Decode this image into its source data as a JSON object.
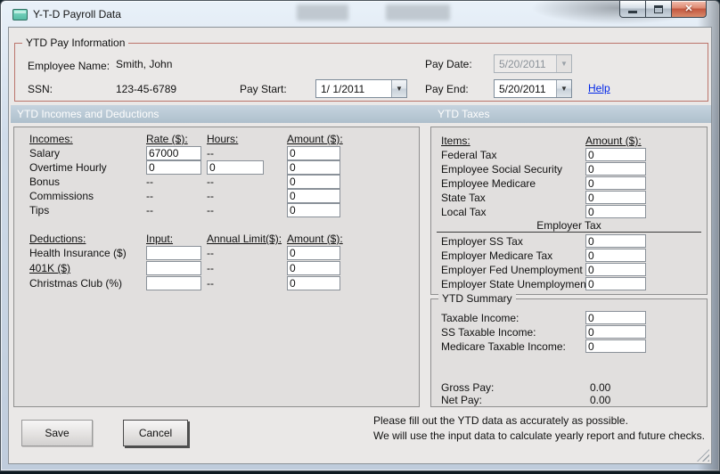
{
  "window": {
    "title": "Y-T-D Payroll Data"
  },
  "icons": {
    "dropdown_arrow": "▼",
    "close": "✕"
  },
  "pay_info": {
    "group_title": "YTD Pay Information",
    "employee_name_label": "Employee Name:",
    "employee_name_value": "Smith, John",
    "ssn_label": "SSN:",
    "ssn_value": "123-45-6789",
    "pay_start_label": "Pay Start:",
    "pay_start_value": "1/ 1/2011",
    "pay_date_label": "Pay Date:",
    "pay_date_value": "5/20/2011",
    "pay_end_label": "Pay End:",
    "pay_end_value": "5/20/2011",
    "help_label": "Help"
  },
  "section_headers": {
    "left": "YTD Incomes and Deductions",
    "right": "YTD Taxes"
  },
  "incomes": {
    "headers": {
      "col1": "Incomes:",
      "col2": "Rate ($):",
      "col3": "Hours:",
      "col4": "Amount ($):"
    },
    "rows": [
      {
        "label": "Salary",
        "rate": "67000",
        "hours": "--",
        "amount": "0"
      },
      {
        "label": "Overtime Hourly",
        "rate": "0",
        "hours": "0",
        "amount": "0"
      },
      {
        "label": "Bonus",
        "rate": "--",
        "hours": "--",
        "amount": "0"
      },
      {
        "label": "Commissions",
        "rate": "--",
        "hours": "--",
        "amount": "0"
      },
      {
        "label": "Tips",
        "rate": "--",
        "hours": "--",
        "amount": "0"
      }
    ]
  },
  "deductions": {
    "headers": {
      "col1": "Deductions:",
      "col2": "Input:",
      "col3": "Annual Limit($):",
      "col4": "Amount ($):"
    },
    "rows": [
      {
        "label": "Health Insurance ($)",
        "input": "",
        "limit": "--",
        "amount": "0"
      },
      {
        "label": "401K ($)",
        "input": "",
        "limit": "--",
        "amount": "0"
      },
      {
        "label": "Christmas Club (%)",
        "input": "",
        "limit": "--",
        "amount": "0"
      }
    ]
  },
  "taxes": {
    "headers": {
      "col1": "Items:",
      "col2": "Amount ($):"
    },
    "employee_rows": [
      {
        "label": "Federal Tax",
        "amount": "0"
      },
      {
        "label": "Employee Social Security",
        "amount": "0"
      },
      {
        "label": "Employee Medicare",
        "amount": "0"
      },
      {
        "label": "State Tax",
        "amount": "0"
      },
      {
        "label": "Local Tax",
        "amount": "0"
      }
    ],
    "employer_header": "Employer Tax",
    "employer_rows": [
      {
        "label": "Employer SS Tax",
        "amount": "0"
      },
      {
        "label": "Employer Medicare Tax",
        "amount": "0"
      },
      {
        "label": "Employer Fed Unemployment",
        "amount": "0"
      },
      {
        "label": "Employer State Unemployment",
        "amount": "0"
      }
    ]
  },
  "summary": {
    "group_title": "YTD Summary",
    "rows": [
      {
        "label": "Taxable Income:",
        "value": "0"
      },
      {
        "label": "SS Taxable Income:",
        "value": "0"
      },
      {
        "label": "Medicare Taxable Income:",
        "value": "0"
      }
    ],
    "gross_pay_label": "Gross Pay:",
    "gross_pay_value": "0.00",
    "net_pay_label": "Net Pay:",
    "net_pay_value": "0.00"
  },
  "footer": {
    "save_label": "Save",
    "cancel_label": "Cancel",
    "note_line1": "Please fill out the YTD data as accurately as possible.",
    "note_line2": "We will use the input data to calculate yearly report and future checks."
  }
}
